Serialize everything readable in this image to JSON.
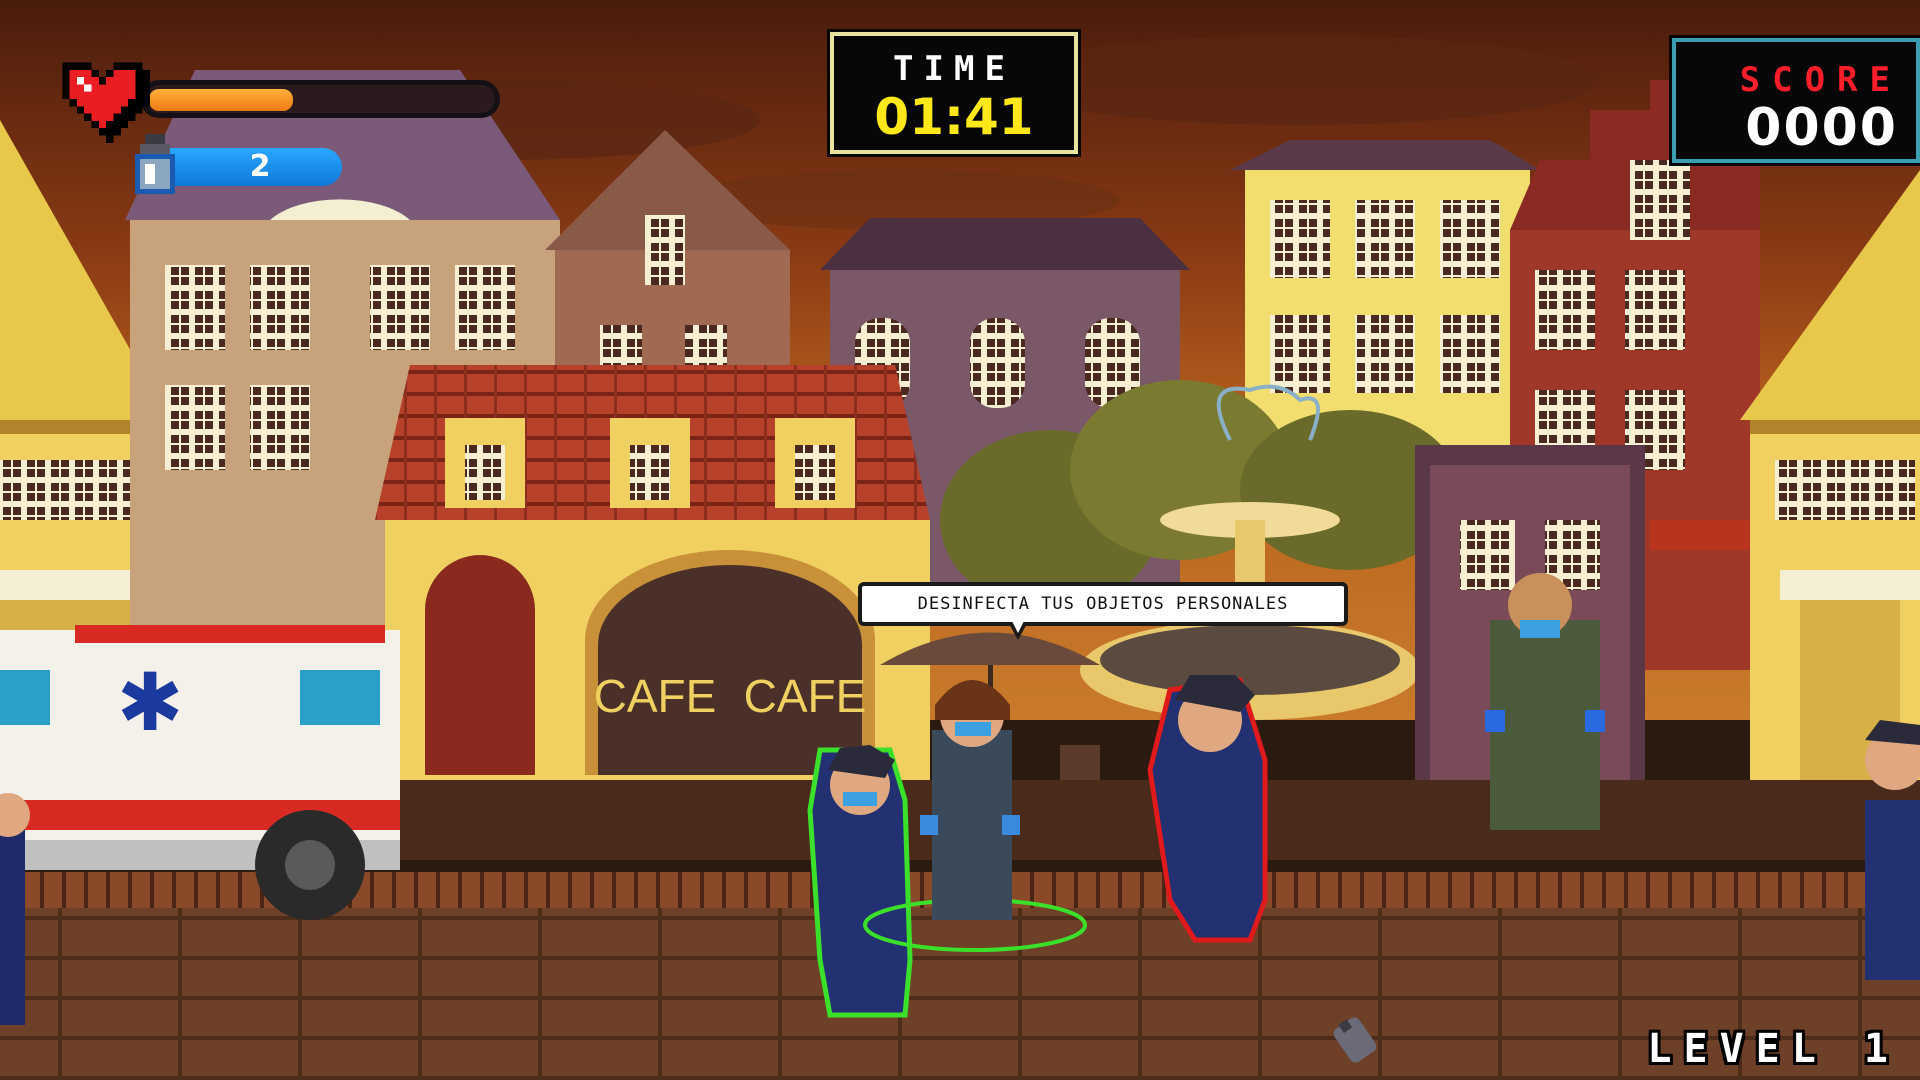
{
  "hud": {
    "health": {
      "level": 0.42,
      "icon": "heart-icon",
      "fill_color": "#f0901e"
    },
    "sanitizer": {
      "count": "2",
      "icon": "sanitizer-bottle-icon",
      "color": "#1a8ef0"
    },
    "timer": {
      "label": "TIME",
      "value": "01:41"
    },
    "score": {
      "label": "SCORE",
      "value": "0000"
    },
    "level": {
      "label": "LEVEL 1"
    }
  },
  "speech_bubble": {
    "text": "DESINFECTA TUS OBJETOS PERSONALES"
  },
  "scene": {
    "cafe_sign_left": "CAFE",
    "cafe_sign_right": "CAFE"
  }
}
